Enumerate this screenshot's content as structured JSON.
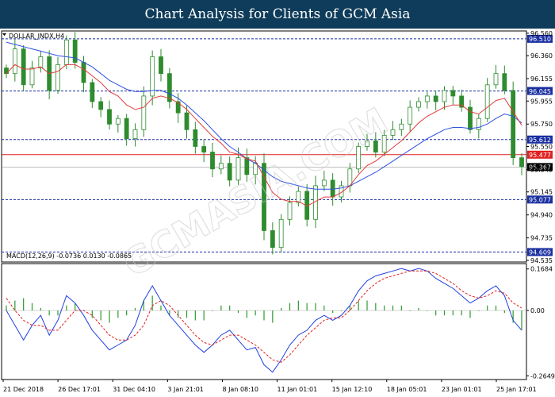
{
  "banner": {
    "title": "Chart Analysis for Clients of GCM Asia"
  },
  "watermark": "GCMASIA.COM",
  "colors": {
    "banner_bg": "#0e3c5a",
    "candle": "#2e8b2e",
    "ma_fast": "#e23b3b",
    "ma_slow": "#3050e0",
    "level_line": "#1a2fa0",
    "level_label_bg": "#1a2fa0",
    "current_price_line": "#e02020",
    "current_price_label_bg": "#e02020",
    "last_price_bg": "#000000",
    "histogram": "#2e9b2e",
    "macd_line": "#2040e0",
    "signal_line": "#e02020"
  },
  "chart_data": [
    {
      "type": "line",
      "symbol": "DOLLAR_INDX,H4",
      "y_ticks": [
        "96.560",
        "96.360",
        "96.155",
        "95.955",
        "95.750",
        "95.550",
        "95.345",
        "95.145",
        "94.940",
        "94.735",
        "94.535"
      ],
      "ylim": [
        94.52,
        96.58
      ],
      "x_tick_labels": [
        "21 Dec 2018",
        "26 Dec 17:01",
        "31 Dec 04:10",
        "3 Jan 21:01",
        "8 Jan 08:10",
        "11 Jan 01:01",
        "15 Jan 12:10",
        "18 Jan 05:01",
        "23 Jan 01:01",
        "25 Jan 17:01"
      ],
      "horizontal_levels": [
        96.51,
        96.045,
        95.612,
        95.077,
        94.609
      ],
      "current_price_level": 95.477,
      "last_price": 95.367,
      "close_series": [
        96.2,
        96.42,
        96.1,
        96.25,
        96.35,
        96.05,
        96.28,
        96.5,
        96.3,
        96.12,
        95.95,
        95.88,
        95.75,
        95.8,
        95.62,
        95.7,
        96.0,
        96.35,
        96.2,
        95.95,
        95.85,
        95.7,
        95.55,
        95.5,
        95.35,
        95.4,
        95.25,
        95.45,
        95.3,
        95.4,
        94.8,
        94.65,
        94.9,
        95.05,
        95.15,
        94.9,
        95.2,
        95.25,
        95.1,
        95.2,
        95.35,
        95.55,
        95.6,
        95.5,
        95.65,
        95.7,
        95.75,
        95.9,
        95.95,
        96.0,
        95.95,
        96.05,
        96.0,
        95.9,
        95.7,
        95.8,
        96.1,
        96.2,
        96.05,
        95.45,
        95.37
      ],
      "ma_fast_series": [
        96.2,
        96.28,
        96.24,
        96.24,
        96.26,
        96.2,
        96.22,
        96.28,
        96.28,
        96.24,
        96.18,
        96.12,
        96.04,
        96.0,
        95.92,
        95.88,
        95.9,
        95.98,
        96.0,
        95.98,
        95.94,
        95.88,
        95.8,
        95.72,
        95.64,
        95.58,
        95.5,
        95.48,
        95.44,
        95.42,
        95.28,
        95.14,
        95.08,
        95.06,
        95.06,
        95.02,
        95.06,
        95.1,
        95.1,
        95.14,
        95.2,
        95.3,
        95.38,
        95.42,
        95.48,
        95.54,
        95.6,
        95.68,
        95.76,
        95.82,
        95.86,
        95.9,
        95.92,
        95.92,
        95.86,
        95.84,
        95.9,
        95.96,
        95.98,
        95.86,
        95.74
      ],
      "ma_slow_series": [
        96.48,
        96.46,
        96.44,
        96.42,
        96.4,
        96.38,
        96.36,
        96.35,
        96.34,
        96.3,
        96.26,
        96.2,
        96.14,
        96.1,
        96.06,
        96.04,
        96.04,
        96.05,
        96.05,
        96.02,
        95.98,
        95.92,
        95.85,
        95.78,
        95.7,
        95.62,
        95.55,
        95.5,
        95.44,
        95.4,
        95.34,
        95.28,
        95.24,
        95.22,
        95.2,
        95.18,
        95.17,
        95.17,
        95.17,
        95.18,
        95.2,
        95.24,
        95.28,
        95.32,
        95.37,
        95.42,
        95.47,
        95.52,
        95.57,
        95.62,
        95.66,
        95.7,
        95.72,
        95.72,
        95.71,
        95.72,
        95.75,
        95.8,
        95.84,
        95.82,
        95.76
      ]
    },
    {
      "type": "line",
      "label": "MACD(12,26,9) -0.0736 0.0130 -0.0865",
      "y_ticks": [
        "0.1684",
        "0.00",
        "-0.2649"
      ],
      "ylim": [
        -0.28,
        0.19
      ],
      "macd_series": [
        0.0,
        -0.06,
        -0.12,
        -0.06,
        -0.02,
        -0.1,
        -0.04,
        0.06,
        0.03,
        -0.02,
        -0.08,
        -0.12,
        -0.16,
        -0.14,
        -0.12,
        -0.06,
        0.04,
        0.1,
        0.04,
        -0.02,
        -0.06,
        -0.1,
        -0.14,
        -0.17,
        -0.14,
        -0.1,
        -0.08,
        -0.12,
        -0.16,
        -0.15,
        -0.22,
        -0.25,
        -0.2,
        -0.14,
        -0.1,
        -0.08,
        -0.04,
        -0.02,
        -0.04,
        -0.02,
        0.02,
        0.08,
        0.12,
        0.14,
        0.15,
        0.16,
        0.17,
        0.16,
        0.17,
        0.16,
        0.13,
        0.11,
        0.09,
        0.06,
        0.03,
        0.05,
        0.08,
        0.1,
        0.06,
        -0.04,
        -0.08
      ],
      "signal_series": [
        0.05,
        0.0,
        -0.04,
        -0.06,
        -0.06,
        -0.08,
        -0.08,
        -0.04,
        0.0,
        0.0,
        -0.02,
        -0.06,
        -0.1,
        -0.12,
        -0.12,
        -0.1,
        -0.06,
        0.02,
        0.04,
        0.02,
        -0.02,
        -0.06,
        -0.1,
        -0.13,
        -0.14,
        -0.12,
        -0.1,
        -0.1,
        -0.12,
        -0.14,
        -0.17,
        -0.2,
        -0.21,
        -0.18,
        -0.14,
        -0.1,
        -0.07,
        -0.04,
        -0.03,
        -0.03,
        0.0,
        0.04,
        0.08,
        0.11,
        0.13,
        0.14,
        0.15,
        0.16,
        0.16,
        0.16,
        0.15,
        0.13,
        0.11,
        0.08,
        0.06,
        0.05,
        0.06,
        0.08,
        0.07,
        0.03,
        0.01
      ],
      "histogram_series": [
        0.02,
        0.04,
        0.05,
        0.03,
        0.01,
        -0.02,
        -0.02,
        0.02,
        0.03,
        0.0,
        -0.03,
        -0.04,
        -0.05,
        -0.03,
        -0.02,
        0.01,
        0.04,
        0.06,
        0.02,
        -0.02,
        -0.03,
        -0.03,
        -0.04,
        -0.04,
        0.0,
        0.02,
        0.02,
        -0.01,
        -0.03,
        -0.02,
        -0.04,
        -0.05,
        0.01,
        0.03,
        0.04,
        0.03,
        0.03,
        0.02,
        -0.01,
        0.0,
        0.02,
        0.04,
        0.04,
        0.03,
        0.02,
        0.02,
        0.02,
        0.0,
        0.01,
        0.0,
        -0.02,
        -0.02,
        -0.02,
        -0.02,
        -0.03,
        0.0,
        0.02,
        0.02,
        -0.01,
        -0.05,
        -0.08
      ]
    }
  ]
}
